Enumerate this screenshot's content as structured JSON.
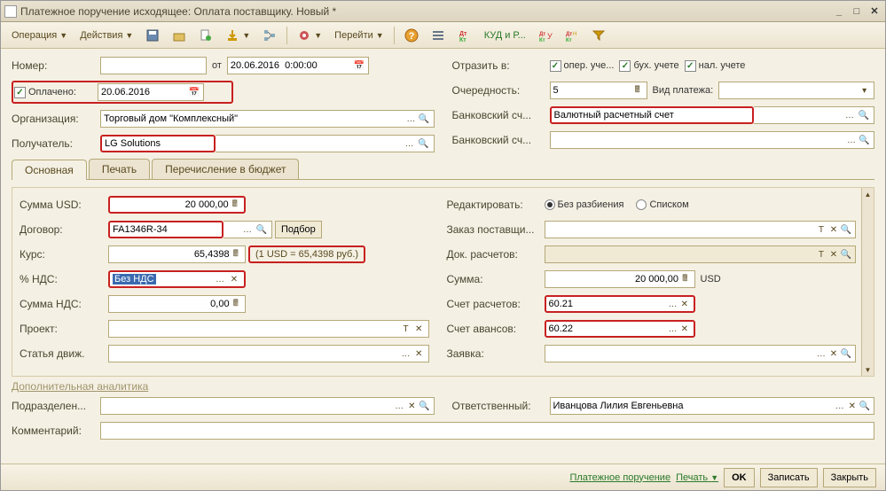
{
  "window": {
    "title": "Платежное поручение исходящее: Оплата поставщику. Новый *"
  },
  "toolbar": {
    "operation": "Операция",
    "actions": "Действия",
    "goto": "Перейти",
    "kudr": "КУД и Р..."
  },
  "header": {
    "number_label": "Номер:",
    "number_value": "",
    "ot": "от",
    "date_value": "20.06.2016  0:00:00",
    "reflect_label": "Отразить в:",
    "oper_label": "опер. уче...",
    "buh_label": "бух. учете",
    "nal_label": "нал. учете",
    "paid_label": "Оплачено:",
    "paid_date": "20.06.2016",
    "priority_label": "Очередность:",
    "priority_value": "5",
    "payment_type_label": "Вид платежа:",
    "payment_type_value": "",
    "org_label": "Организация:",
    "org_value": "Торговый дом \"Комплексный\"",
    "bank_acc1_label": "Банковский сч...",
    "bank_acc1_value": "Валютный расчетный счет",
    "recipient_label": "Получатель:",
    "recipient_value": "LG Solutions",
    "bank_acc2_label": "Банковский сч...",
    "bank_acc2_value": ""
  },
  "tabs": {
    "main": "Основная",
    "print": "Печать",
    "budget": "Перечисление в бюджет"
  },
  "main": {
    "sum_usd_label": "Сумма USD:",
    "sum_usd_value": "20 000,00",
    "edit_label": "Редактировать:",
    "edit_no_split": "Без разбиения",
    "edit_list": "Списком",
    "contract_label": "Договор:",
    "contract_value": "FA1346R-34",
    "podbor": "Подбор",
    "order_label": "Заказ поставщи...",
    "rate_label": "Курс:",
    "rate_value": "65,4398",
    "rate_hint": "(1 USD = 65,4398 руб.)",
    "doc_settle_label": "Док. расчетов:",
    "vat_pct_label": "% НДС:",
    "vat_pct_value": "Без НДС",
    "sum_label": "Сумма:",
    "sum_value": "20 000,00",
    "sum_unit": "USD",
    "vat_sum_label": "Сумма НДС:",
    "vat_sum_value": "0,00",
    "settle_acc_label": "Счет расчетов:",
    "settle_acc_value": "60.21",
    "project_label": "Проект:",
    "advance_acc_label": "Счет авансов:",
    "advance_acc_value": "60.22",
    "cashflow_label": "Статья движ.",
    "request_label": "Заявка:",
    "add_analytics": "Дополнительная аналитика",
    "division_label": "Подразделен...",
    "responsible_label": "Ответственный:",
    "responsible_value": "Иванцова Лилия Евгеньевна",
    "comment_label": "Комментарий:"
  },
  "footer": {
    "payment_order": "Платежное поручение",
    "print": "Печать",
    "ok": "OK",
    "save": "Записать",
    "close": "Закрыть"
  }
}
